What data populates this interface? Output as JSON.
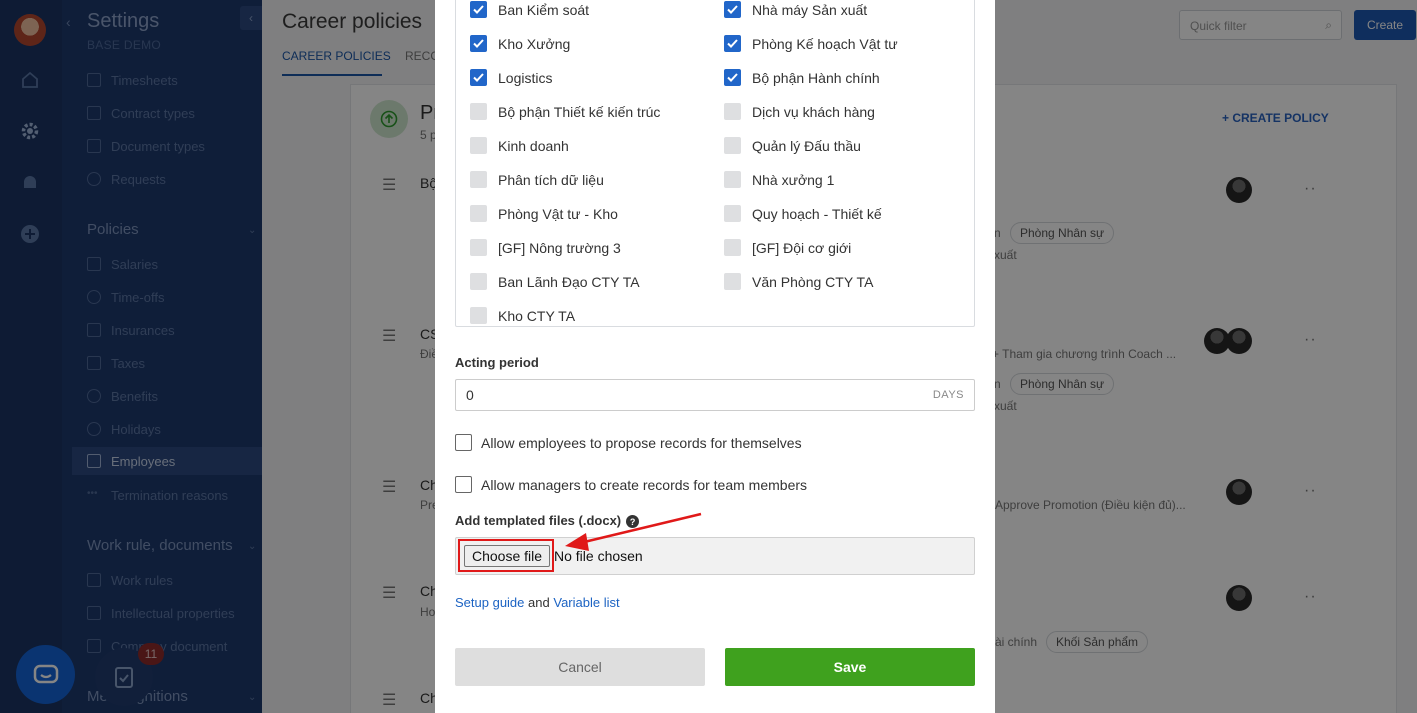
{
  "sidebar": {
    "title": "Settings",
    "subtitle": "BASE DEMO",
    "items_top": [
      "Timesheets",
      "Contract types",
      "Document types",
      "Requests"
    ],
    "policies_section": "Policies",
    "policy_items": [
      "Salaries",
      "Time-offs",
      "Insurances",
      "Taxes",
      "Benefits",
      "Holidays",
      "Employees",
      "Termination reasons"
    ],
    "work_section": "Work rule, documents",
    "work_items": [
      "Work rules",
      "Intellectual properties",
      "Company document"
    ],
    "recognition_section": "Me    ecognitions",
    "task_badge": "11"
  },
  "main": {
    "title": "Career policies",
    "tabs": [
      "CAREER POLICIES",
      "RECO"
    ],
    "quick_filter_placeholder": "Quick filter",
    "create_label": "Create",
    "card_title_partial": "Pr",
    "card_sub_partial": "5 p",
    "create_policy": "+ CREATE POLICY",
    "rows": [
      {
        "title": "Bộ",
        "chips": [
          "Phòng Nhân sự",
          "n",
          "xuất"
        ]
      },
      {
        "title": "CS",
        "sub": "Điề",
        "note": "+ Tham gia chương trình Coach ...",
        "chips": [
          "Phòng Nhân sự",
          "n",
          "xuất"
        ]
      },
      {
        "title": "Ch",
        "sub": "Pre",
        "note": "Approve Promotion (Điều kiện đủ)..."
      },
      {
        "title": "Ch",
        "sub": "Ho",
        "chips": [
          "ài chính",
          "Khối Sản phẩm"
        ]
      },
      {
        "title": "Ch"
      }
    ]
  },
  "modal": {
    "departments": [
      {
        "label": "Ban Kiểm soát",
        "checked": true
      },
      {
        "label": "Nhà máy Sản xuất",
        "checked": true
      },
      {
        "label": "Kho Xưởng",
        "checked": true
      },
      {
        "label": "Phòng Kế hoạch Vật tư",
        "checked": true
      },
      {
        "label": "Logistics",
        "checked": true
      },
      {
        "label": "Bộ phận Hành chính",
        "checked": true
      },
      {
        "label": "Bộ phận Thiết kế kiến trúc",
        "checked": false
      },
      {
        "label": "Dịch vụ khách hàng",
        "checked": false
      },
      {
        "label": "Kinh doanh",
        "checked": false
      },
      {
        "label": "Quản lý Đấu thầu",
        "checked": false
      },
      {
        "label": "Phân tích dữ liệu",
        "checked": false
      },
      {
        "label": "Nhà xưởng 1",
        "checked": false
      },
      {
        "label": "Phòng Vật tư - Kho",
        "checked": false
      },
      {
        "label": "Quy hoạch - Thiết kế",
        "checked": false
      },
      {
        "label": "[GF] Nông trường 3",
        "checked": false
      },
      {
        "label": "[GF] Đội cơ giới",
        "checked": false
      },
      {
        "label": "Ban Lãnh Đạo CTY TA",
        "checked": false
      },
      {
        "label": "Văn Phòng CTY TA",
        "checked": false
      },
      {
        "label": "Kho CTY TA",
        "checked": false
      }
    ],
    "acting_period_label": "Acting period",
    "acting_period_value": "0",
    "acting_period_unit": "DAYS",
    "allow_employees_label": "Allow employees to propose records for themselves",
    "allow_managers_label": "Allow managers to create records for team members",
    "templated_files_label": "Add templated files (.docx)",
    "help_glyph": "?",
    "choose_file_label": "Choose file",
    "no_file_label": "No file chosen",
    "setup_guide": "Setup guide",
    "and_text": "and",
    "variable_list": "Variable list",
    "cancel_label": "Cancel",
    "save_label": "Save"
  },
  "colors": {
    "sidebar_bg": "#1e3a6e",
    "checkbox_on": "#2166c9",
    "save_green": "#3fa11e",
    "highlight_red": "#e01919"
  }
}
